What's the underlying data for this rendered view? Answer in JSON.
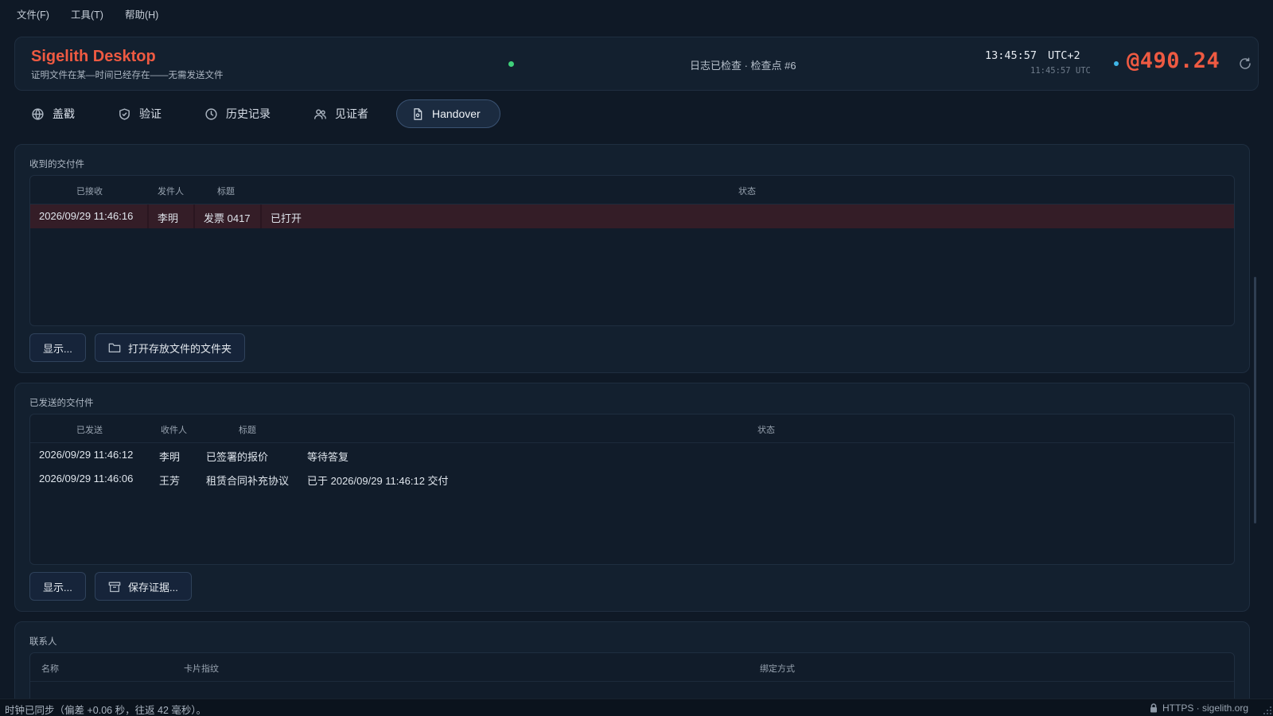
{
  "menu": [
    "文件(F)",
    "工具(T)",
    "帮助(H)"
  ],
  "header": {
    "app_title": "Sigelith Desktop",
    "subtitle": "证明文件在某—时间已经存在——无需发送文件",
    "log_status": "日志已检查 · 检查点 #6",
    "local_time": "13:45:57",
    "timezone": "UTC+2",
    "utc_time": "11:45:57 UTC",
    "beat": "@490.24"
  },
  "tabs": [
    {
      "label": "盖戳",
      "icon": "stamp-icon"
    },
    {
      "label": "验证",
      "icon": "shield-icon"
    },
    {
      "label": "历史记录",
      "icon": "clock-icon"
    },
    {
      "label": "见证者",
      "icon": "users-icon"
    },
    {
      "label": "Handover",
      "icon": "document-icon",
      "active": true
    }
  ],
  "received": {
    "title": "收到的交付件",
    "columns": [
      "已接收",
      "发件人",
      "标题",
      "状态"
    ],
    "rows": [
      {
        "received": "2026/09/29 11:46:16",
        "sender": "李明",
        "subject": "发票 0417",
        "status": "已打开",
        "selected": true
      }
    ],
    "show_button": "显示...",
    "open_folder_button": "打开存放文件的文件夹"
  },
  "sent": {
    "title": "已发送的交付件",
    "columns": [
      "已发送",
      "收件人",
      "标题",
      "状态"
    ],
    "rows": [
      {
        "sent": "2026/09/29 11:46:12",
        "recipient": "李明",
        "subject": "已签署的报价",
        "status": "等待答复"
      },
      {
        "sent": "2026/09/29 11:46:06",
        "recipient": "王芳",
        "subject": "租赁合同补充协议",
        "status": "已于 2026/09/29 11:46:12 交付"
      }
    ],
    "show_button": "显示...",
    "save_evidence_button": "保存证据..."
  },
  "contacts": {
    "title": "联系人",
    "columns": [
      "名称",
      "卡片指纹",
      "绑定方式"
    ]
  },
  "statusbar": {
    "text": "时钟已同步（偏差 +0.06 秒，往返 42 毫秒）。",
    "security": "HTTPS · sigelith.org"
  },
  "colors": {
    "accent": "#ee5a42",
    "background": "#0f1926",
    "panel": "#13202f",
    "selected_row": "#341d27",
    "sync_ok": "#3fd07a",
    "beat_dot": "#3fb6e8"
  }
}
